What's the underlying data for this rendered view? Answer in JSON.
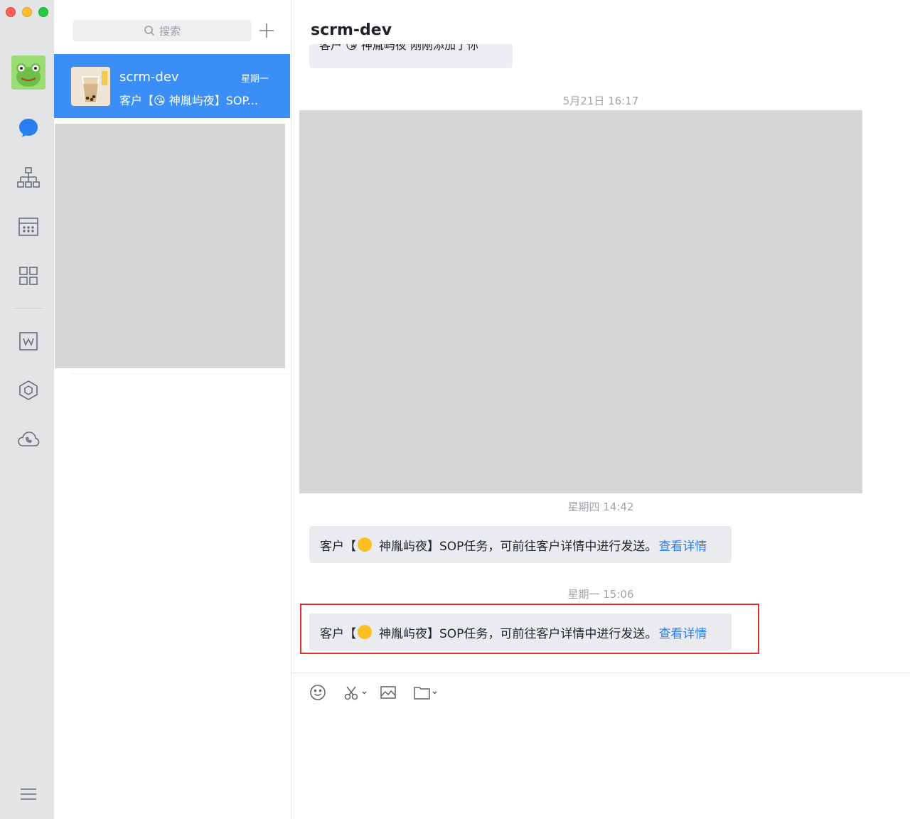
{
  "window": {
    "controls": [
      "close",
      "minimize",
      "maximize"
    ]
  },
  "rail": {
    "items": [
      {
        "name": "messages-icon",
        "active": true
      },
      {
        "name": "contacts-org-icon"
      },
      {
        "name": "calendar-icon"
      },
      {
        "name": "workbench-grid-icon"
      },
      {
        "name": "document-icon"
      },
      {
        "name": "cube-app-icon"
      },
      {
        "name": "cloud-phone-icon"
      },
      {
        "name": "menu-icon"
      }
    ]
  },
  "search": {
    "placeholder": "搜索"
  },
  "conversations": [
    {
      "name": "scrm-dev",
      "time": "星期一",
      "preview": "客户【😘 神胤屿夜】SOP..."
    }
  ],
  "chat": {
    "title": "scrm-dev",
    "partial_message_text": "客户 😘 神胤屿夜 刚刚添加了你",
    "timestamps": [
      "5月21日 16:17",
      "星期四 14:42",
      "星期一 15:06"
    ],
    "messages": [
      {
        "prefix": "客户【",
        "name": "神胤屿夜】SOP任务，可前往客户详情中进行发送。",
        "link": "查看详情"
      },
      {
        "prefix": "客户【",
        "name": "神胤屿夜】SOP任务，可前往客户详情中进行发送。",
        "link": "查看详情"
      }
    ]
  },
  "composer": {
    "tools": [
      "emoji-icon",
      "screenshot-scissors-icon",
      "image-icon",
      "folder-icon"
    ]
  },
  "colors": {
    "accent": "#3a8ef6",
    "link": "#2f7be8",
    "highlight": "#e3322b"
  }
}
